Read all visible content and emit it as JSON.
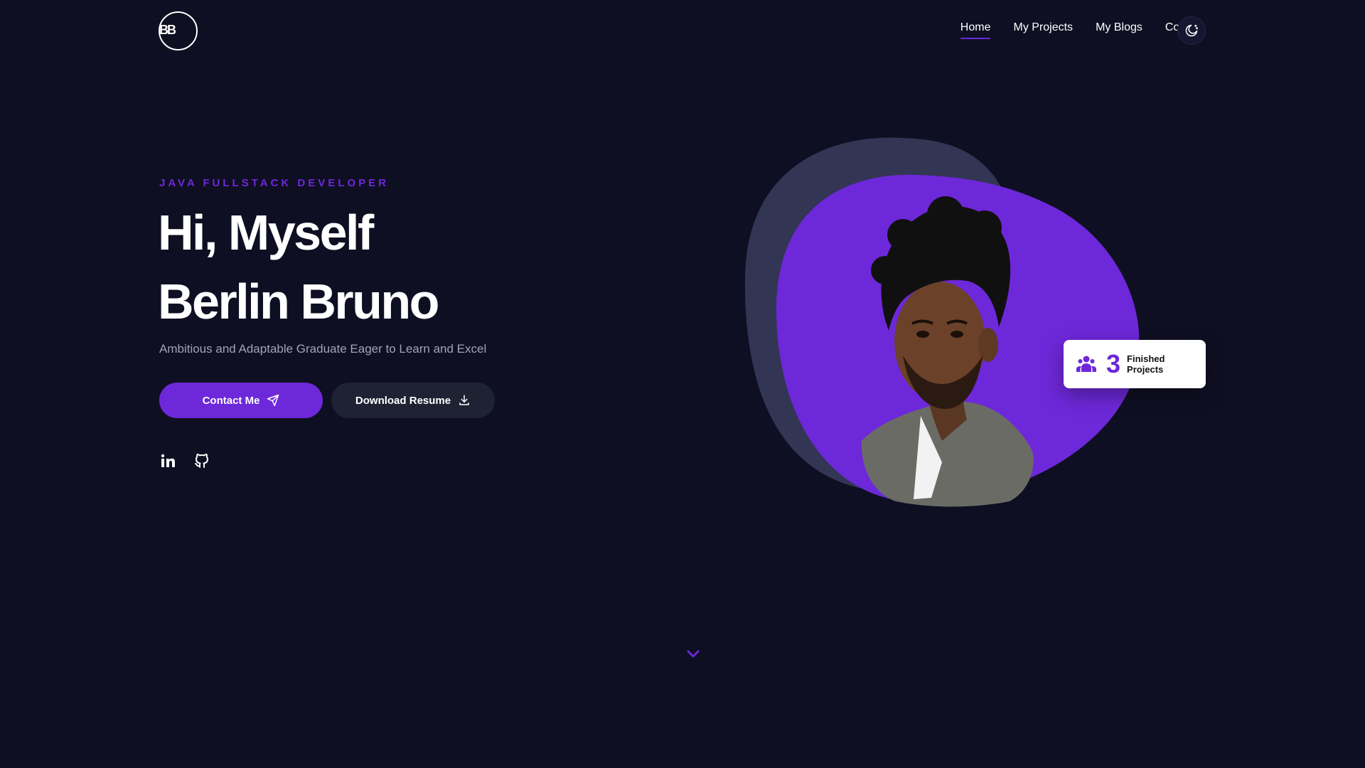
{
  "header": {
    "logo_text": "BB",
    "nav": [
      {
        "label": "Home",
        "active": true
      },
      {
        "label": "My Projects"
      },
      {
        "label": "My Blogs"
      },
      {
        "label": "Contact"
      }
    ],
    "theme_toggle_icon": "moon-icon"
  },
  "hero": {
    "role": "JAVA FULLSTACK DEVELOPER",
    "greeting_line1": "Hi, Myself",
    "greeting_line2": "Berlin Bruno",
    "tagline": "Ambitious and Adaptable Graduate Eager to Learn and Excel",
    "contact_button": "Contact Me",
    "resume_button": "Download Resume",
    "socials": [
      "linkedin-icon",
      "github-icon"
    ]
  },
  "badge": {
    "number": "3",
    "label": "Finished Projects",
    "icon": "users-icon"
  },
  "colors": {
    "background": "#0f0f23",
    "accent": "#6d28d9",
    "blob_back": "#333554"
  }
}
